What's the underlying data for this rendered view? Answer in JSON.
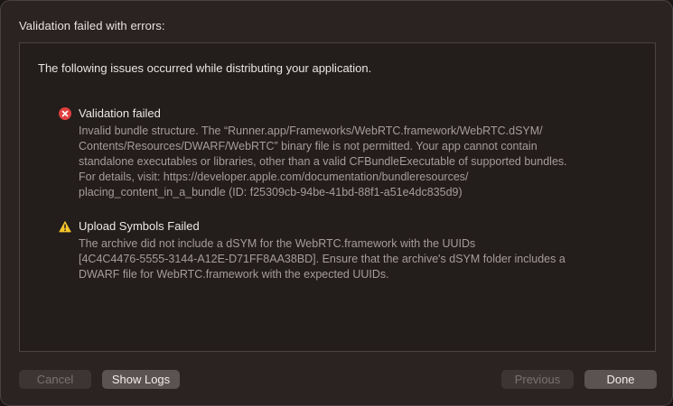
{
  "window": {
    "title": "Validation failed with errors:"
  },
  "panel": {
    "intro": "The following issues occurred while distributing your application."
  },
  "issues": [
    {
      "icon": "error-icon",
      "title": "Validation failed",
      "lines": [
        "Invalid bundle structure. The “Runner.app/Frameworks/WebRTC.framework/WebRTC.dSYM/",
        "Contents/Resources/DWARF/WebRTC” binary file is not permitted. Your app cannot contain",
        "standalone executables or libraries, other than a valid CFBundleExecutable of supported bundles.",
        "For details, visit: https://developer.apple.com/documentation/bundleresources/",
        "placing_content_in_a_bundle (ID: f25309cb-94be-41bd-88f1-a51e4dc835d9)"
      ]
    },
    {
      "icon": "warning-icon",
      "title": "Upload Symbols Failed",
      "lines": [
        "The archive did not include a dSYM for the WebRTC.framework with the UUIDs",
        "[4C4C4476-5555-3144-A12E-D71FF8AA38BD]. Ensure that the archive's dSYM folder includes a",
        "DWARF file for WebRTC.framework with the expected UUIDs."
      ]
    }
  ],
  "buttons": {
    "cancel": "Cancel",
    "show_logs": "Show Logs",
    "previous": "Previous",
    "done": "Done"
  },
  "colors": {
    "error": "#e0403f",
    "warning": "#f5c52b"
  }
}
